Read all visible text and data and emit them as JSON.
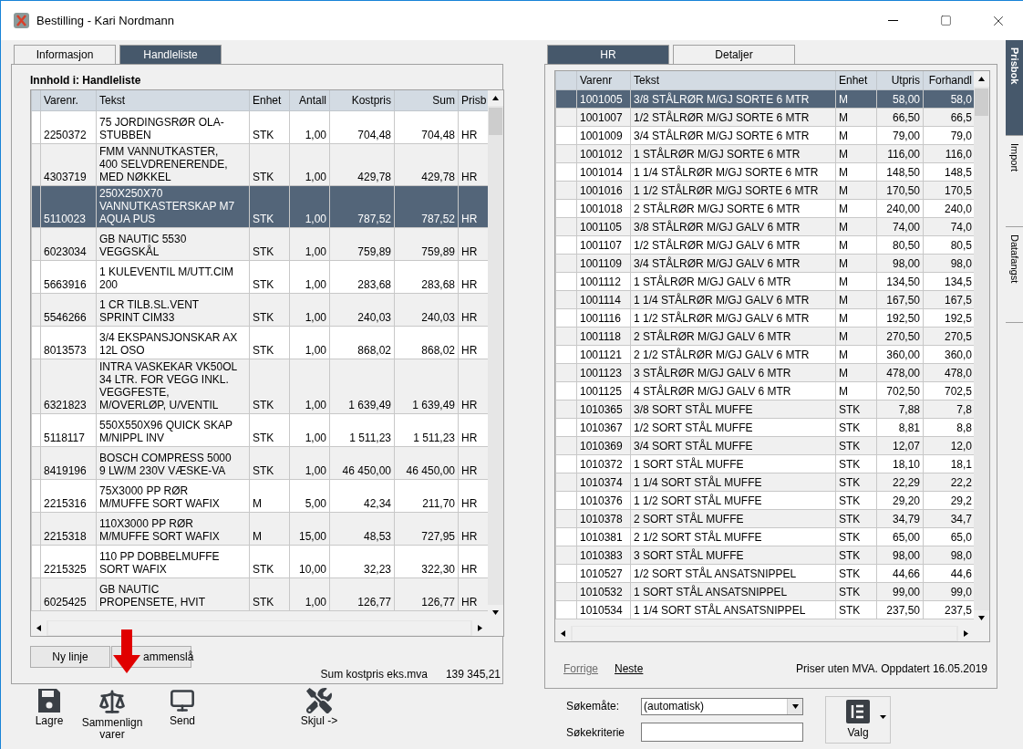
{
  "window": {
    "title": "Bestilling - Kari Nordmann"
  },
  "left_tabs": [
    {
      "label": "Informasjon",
      "selected": false
    },
    {
      "label": "Handleliste",
      "selected": true
    }
  ],
  "left_panel": {
    "heading": "Innhold i: Handleliste",
    "table": {
      "columns": [
        {
          "label": "Varenr.",
          "kind": "text"
        },
        {
          "label": "Tekst",
          "kind": "text"
        },
        {
          "label": "Enhet",
          "kind": "text"
        },
        {
          "label": "Antall",
          "kind": "number"
        },
        {
          "label": "Kostpris",
          "kind": "number"
        },
        {
          "label": "Sum",
          "kind": "number"
        },
        {
          "label": "Prisb",
          "kind": "text"
        }
      ],
      "rows": [
        {
          "cells": [
            "2250372",
            "75 JORDINGSRØR OLA-STUBBEN",
            "STK",
            "1,00",
            "704,48",
            "704,48",
            "HR"
          ],
          "selected": false
        },
        {
          "cells": [
            "4303719",
            "FMM VANNUTKASTER, 400 SELVDRENERENDE, MED NØKKEL",
            "STK",
            "1,00",
            "429,78",
            "429,78",
            "HR"
          ],
          "selected": false
        },
        {
          "cells": [
            "5110023",
            "250X250X70 VANNUTKASTERSKAP M7 AQUA PUS",
            "STK",
            "1,00",
            "787,52",
            "787,52",
            "HR"
          ],
          "selected": true
        },
        {
          "cells": [
            "6023034",
            "GB NAUTIC 5530 VEGGSKÅL",
            "STK",
            "1,00",
            "759,89",
            "759,89",
            "HR"
          ],
          "selected": false
        },
        {
          "cells": [
            "5663916",
            "1 KULEVENTIL M/UTT.CIM 200",
            "STK",
            "1,00",
            "283,68",
            "283,68",
            "HR"
          ],
          "selected": false
        },
        {
          "cells": [
            "5546266",
            "1 CR TILB.SL.VENT SPRINT CIM33",
            "STK",
            "1,00",
            "240,03",
            "240,03",
            "HR"
          ],
          "selected": false
        },
        {
          "cells": [
            "8013573",
            "3/4 EKSPANSJONSKAR AX 12L OSO",
            "STK",
            "1,00",
            "868,02",
            "868,02",
            "HR"
          ],
          "selected": false
        },
        {
          "cells": [
            "6321823",
            "INTRA VASKEKAR VK50OL 34 LTR. FOR VEGG INKL. VEGGFESTE, M/OVERLØP, U/VENTIL",
            "STK",
            "1,00",
            "1 639,49",
            "1 639,49",
            "HR"
          ],
          "selected": false
        },
        {
          "cells": [
            "5118117",
            "550X550X96 QUICK SKAP M/NIPPL INV",
            "STK",
            "1,00",
            "1 511,23",
            "1 511,23",
            "HR"
          ],
          "selected": false
        },
        {
          "cells": [
            "8419196",
            "BOSCH COMPRESS 5000 9 LW/M 230V VÆSKE-VA",
            "STK",
            "1,00",
            "46 450,00",
            "46 450,00",
            "HR"
          ],
          "selected": false
        },
        {
          "cells": [
            "2215316",
            "75X3000 PP RØR M/MUFFE SORT WAFIX",
            "M",
            "5,00",
            "42,34",
            "211,70",
            "HR"
          ],
          "selected": false
        },
        {
          "cells": [
            "2215318",
            "110X3000 PP RØR M/MUFFE SORT WAFIX",
            "M",
            "15,00",
            "48,53",
            "727,95",
            "HR"
          ],
          "selected": false
        },
        {
          "cells": [
            "2215325",
            "110 PP DOBBELMUFFE SORT WAFIX",
            "STK",
            "10,00",
            "32,23",
            "322,30",
            "HR"
          ],
          "selected": false
        },
        {
          "cells": [
            "6025425",
            "GB NAUTIC PROPENSETE, HVIT",
            "STK",
            "1,00",
            "126,77",
            "126,77",
            "HR"
          ],
          "selected": false
        }
      ]
    },
    "buttons": [
      "Ny linje",
      "ammenslå"
    ],
    "sum_label": "Sum kostpris eks.mva",
    "sum_value": "139 345,21"
  },
  "toolbar": [
    {
      "label": "Lagre",
      "kind": "save"
    },
    {
      "label": "Sammenlign varer",
      "kind": "compare"
    },
    {
      "label": "Send",
      "kind": "send"
    },
    {
      "label": "Skjul ->",
      "kind": "hide"
    }
  ],
  "right_tabs": [
    {
      "label": "HR",
      "selected": true
    },
    {
      "label": "Detaljer",
      "selected": false
    }
  ],
  "right_table": {
    "columns": [
      {
        "label": "Varenr",
        "kind": "text"
      },
      {
        "label": "Tekst",
        "kind": "text"
      },
      {
        "label": "Enhet",
        "kind": "text"
      },
      {
        "label": "Utpris",
        "kind": "number"
      },
      {
        "label": "Forhandl",
        "kind": "number"
      }
    ],
    "rows": [
      {
        "cells": [
          "1001005",
          "3/8 STÅLRØR M/GJ SORTE 6 MTR",
          "M",
          "58,00",
          "58,0"
        ],
        "selected": true
      },
      {
        "cells": [
          "1001007",
          "1/2 STÅLRØR M/GJ SORTE 6 MTR",
          "M",
          "66,50",
          "66,5"
        ],
        "selected": false
      },
      {
        "cells": [
          "1001009",
          "3/4 STÅLRØR M/GJ SORTE 6 MTR",
          "M",
          "79,00",
          "79,0"
        ],
        "selected": false
      },
      {
        "cells": [
          "1001012",
          "1 STÅLRØR M/GJ SORTE 6 MTR",
          "M",
          "116,00",
          "116,0"
        ],
        "selected": false
      },
      {
        "cells": [
          "1001014",
          "1 1/4 STÅLRØR M/GJ SORTE 6 MTR",
          "M",
          "148,50",
          "148,5"
        ],
        "selected": false
      },
      {
        "cells": [
          "1001016",
          "1 1/2 STÅLRØR M/GJ SORTE 6 MTR",
          "M",
          "170,50",
          "170,5"
        ],
        "selected": false
      },
      {
        "cells": [
          "1001018",
          "2 STÅLRØR M/GJ SORTE 6 MTR",
          "M",
          "240,00",
          "240,0"
        ],
        "selected": false
      },
      {
        "cells": [
          "1001105",
          "3/8 STÅLRØR M/GJ GALV 6 MTR",
          "M",
          "74,00",
          "74,0"
        ],
        "selected": false
      },
      {
        "cells": [
          "1001107",
          "1/2 STÅLRØR M/GJ GALV 6 MTR",
          "M",
          "80,50",
          "80,5"
        ],
        "selected": false
      },
      {
        "cells": [
          "1001109",
          "3/4 STÅLRØR M/GJ GALV 6 MTR",
          "M",
          "98,00",
          "98,0"
        ],
        "selected": false
      },
      {
        "cells": [
          "1001112",
          "1 STÅLRØR M/GJ GALV 6 MTR",
          "M",
          "134,50",
          "134,5"
        ],
        "selected": false
      },
      {
        "cells": [
          "1001114",
          "1 1/4 STÅLRØR M/GJ GALV 6 MTR",
          "M",
          "167,50",
          "167,5"
        ],
        "selected": false
      },
      {
        "cells": [
          "1001116",
          "1 1/2 STÅLRØR M/GJ GALV 6 MTR",
          "M",
          "192,50",
          "192,5"
        ],
        "selected": false
      },
      {
        "cells": [
          "1001118",
          "2 STÅLRØR M/GJ GALV 6 MTR",
          "M",
          "270,50",
          "270,5"
        ],
        "selected": false
      },
      {
        "cells": [
          "1001121",
          "2 1/2 STÅLRØR M/GJ GALV 6 MTR",
          "M",
          "360,00",
          "360,0"
        ],
        "selected": false
      },
      {
        "cells": [
          "1001123",
          "3 STÅLRØR M/GJ GALV 6 MTR",
          "M",
          "478,00",
          "478,0"
        ],
        "selected": false
      },
      {
        "cells": [
          "1001125",
          "4 STÅLRØR M/GJ GALV 6 MTR",
          "M",
          "702,50",
          "702,5"
        ],
        "selected": false
      },
      {
        "cells": [
          "1010365",
          "3/8 SORT STÅL MUFFE",
          "STK",
          "7,88",
          "7,8"
        ],
        "selected": false
      },
      {
        "cells": [
          "1010367",
          "1/2 SORT STÅL MUFFE",
          "STK",
          "8,81",
          "8,8"
        ],
        "selected": false
      },
      {
        "cells": [
          "1010369",
          "3/4 SORT STÅL MUFFE",
          "STK",
          "12,07",
          "12,0"
        ],
        "selected": false
      },
      {
        "cells": [
          "1010372",
          "1 SORT STÅL MUFFE",
          "STK",
          "18,10",
          "18,1"
        ],
        "selected": false
      },
      {
        "cells": [
          "1010374",
          "1 1/4 SORT STÅL MUFFE",
          "STK",
          "22,29",
          "22,2"
        ],
        "selected": false
      },
      {
        "cells": [
          "1010376",
          "1 1/2 SORT STÅL MUFFE",
          "STK",
          "29,20",
          "29,2"
        ],
        "selected": false
      },
      {
        "cells": [
          "1010378",
          "2 SORT STÅL MUFFE",
          "STK",
          "34,79",
          "34,7"
        ],
        "selected": false
      },
      {
        "cells": [
          "1010381",
          "2 1/2 SORT STÅL MUFFE",
          "STK",
          "65,00",
          "65,0"
        ],
        "selected": false
      },
      {
        "cells": [
          "1010383",
          "3 SORT STÅL MUFFE",
          "STK",
          "98,00",
          "98,0"
        ],
        "selected": false
      },
      {
        "cells": [
          "1010527",
          "1/2 SORT STÅL ANSATSNIPPEL",
          "STK",
          "44,66",
          "44,6"
        ],
        "selected": false
      },
      {
        "cells": [
          "1010532",
          "1 SORT STÅL ANSATSNIPPEL",
          "STK",
          "99,00",
          "99,0"
        ],
        "selected": false
      },
      {
        "cells": [
          "1010534",
          "1 1/4 SORT STÅL ANSATSNIPPEL",
          "STK",
          "237,50",
          "237,5"
        ],
        "selected": false
      }
    ]
  },
  "nav_links": [
    {
      "label": "Forrige",
      "disabled": true
    },
    {
      "label": "Neste",
      "disabled": false
    }
  ],
  "price_note": "Priser uten MVA. Oppdatert 16.05.2019",
  "search": {
    "mode_label": "Søkemåte:",
    "mode_value": "(automatisk)",
    "criteria_label": "Søkekriterie"
  },
  "valg_button": "Valg",
  "side_tabs": [
    {
      "label": "Prisbok",
      "selected": true
    },
    {
      "label": "Import",
      "selected": false
    },
    {
      "label": "Datafangst",
      "selected": false
    }
  ]
}
